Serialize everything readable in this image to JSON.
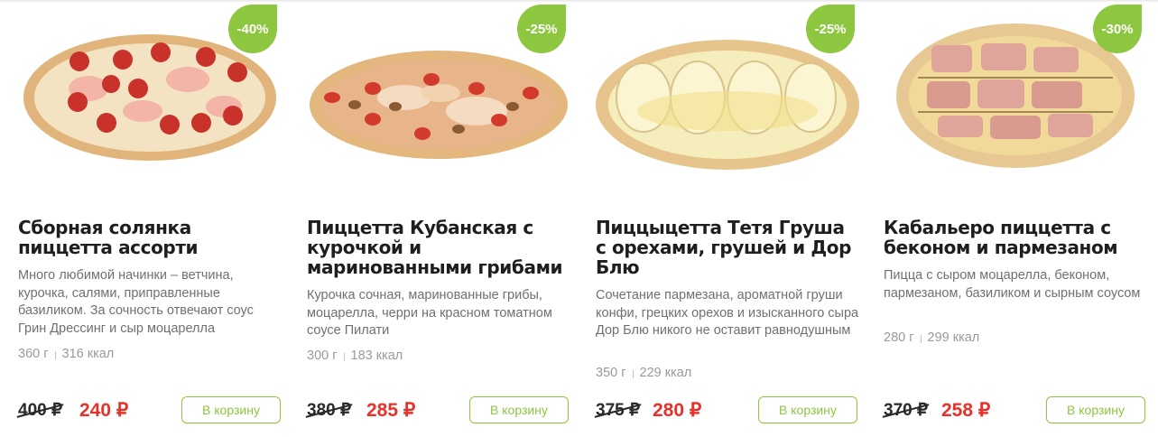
{
  "colors": {
    "accent_green": "#8dc63f",
    "price_red": "#e5332a",
    "text_dark": "#1e1e1e",
    "text_muted": "#707070"
  },
  "products": [
    {
      "badge": "-40%",
      "title": "Сборная солянка пиццетта ассорти",
      "description": "Много любимой начинки – ветчина, курочка, салями, приправленные базиликом. За сочность отвечают соус Грин Дрессинг и сыр моцарелла",
      "weight": "360 г",
      "calories": "316 ккал",
      "old_price": "400 ₽",
      "new_price": "240 ₽",
      "button": "В корзину"
    },
    {
      "badge": "-25%",
      "title": "Пиццетта Кубанская с курочкой и маринованными грибами",
      "description": "Курочка сочная, маринованные грибы, моцарелла, черри на красном томатном соусе Пилати",
      "weight": "300 г",
      "calories": "183 ккал",
      "old_price": "380 ₽",
      "new_price": "285 ₽",
      "button": "В корзину"
    },
    {
      "badge": "-25%",
      "title": "Пиццыцетта Тетя Груша с орехами, грушей и Дор Блю",
      "description": "Сочетание пармезана, ароматной груши конфи, грецких орехов и изысканного сыра Дор Блю никого не оставит равнодушным",
      "weight": "350 г",
      "calories": "229 ккал",
      "old_price": "375 ₽",
      "new_price": "280 ₽",
      "button": "В корзину"
    },
    {
      "badge": "-30%",
      "title": "Кабальеро пиццетта с беконом и пармезаном",
      "description": "Пицца с сыром моцарелла, беконом, пармезаном, базиликом и сырным соусом",
      "weight": "280 г",
      "calories": "299 ккал",
      "old_price": "370 ₽",
      "new_price": "258 ₽",
      "button": "В корзину"
    }
  ]
}
